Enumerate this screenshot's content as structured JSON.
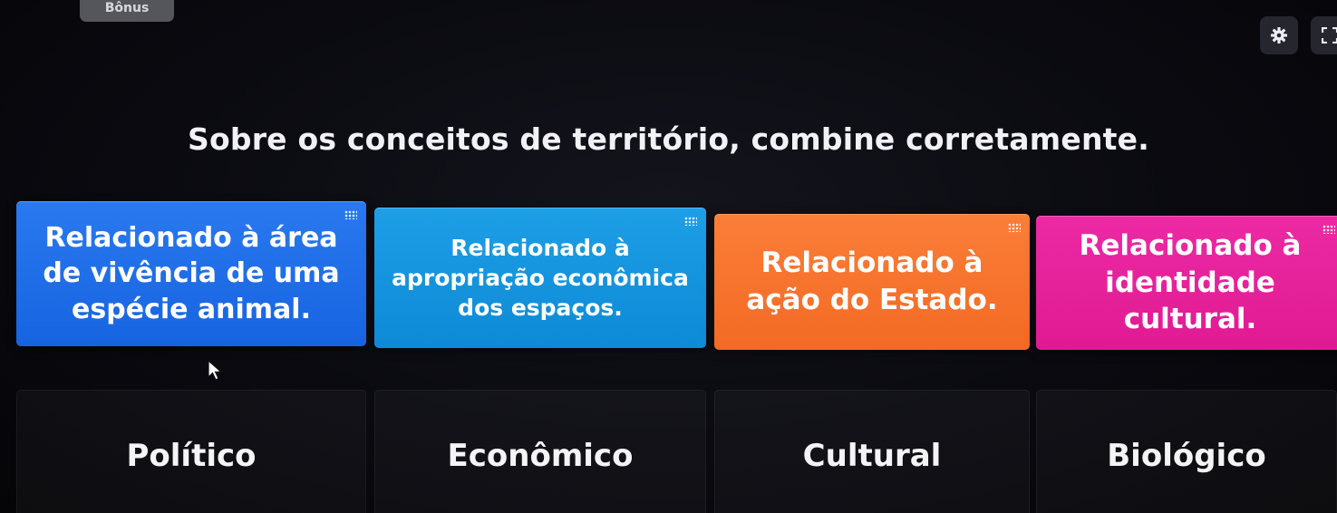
{
  "header": {
    "tab_label": "Bônus",
    "settings_icon": "gear-icon",
    "fullscreen_icon": "fullscreen-icon"
  },
  "question": {
    "text": "Sobre os conceitos de território, combine corretamente."
  },
  "cards": [
    {
      "text": "Relacionado à área de vivência de uma espécie animal.",
      "color": "#2474ec"
    },
    {
      "text": "Relacionado à apropriação econômica dos espaços.",
      "color": "#1497e0"
    },
    {
      "text": "Relacionado à ação do Estado.",
      "color": "#f6742d"
    },
    {
      "text": "Relacionado à identidade cultural.",
      "color": "#e6229b"
    }
  ],
  "targets": [
    {
      "label": "Político"
    },
    {
      "label": "Econômico"
    },
    {
      "label": "Cultural"
    },
    {
      "label": "Biológico"
    }
  ]
}
